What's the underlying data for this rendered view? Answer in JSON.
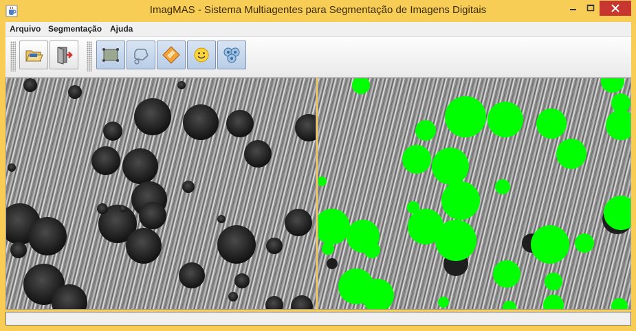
{
  "window": {
    "title": "ImagMAS - Sistema Multiagentes para Segmentação de Imagens Digitais",
    "icon": "java-cup-icon",
    "controls": [
      "minimize",
      "maximize",
      "close"
    ]
  },
  "menu": {
    "items": [
      {
        "label": "Arquivo"
      },
      {
        "label": "Segmentação"
      },
      {
        "label": "Ajuda"
      }
    ]
  },
  "toolbar": {
    "file_group": [
      {
        "icon": "open-folder-icon",
        "active": false
      },
      {
        "icon": "exit-door-icon",
        "active": false
      }
    ],
    "tools_group": [
      {
        "icon": "image-frame-icon",
        "active": true
      },
      {
        "icon": "lasso-blobs-icon",
        "active": true
      },
      {
        "icon": "diamond-warning-icon",
        "active": true
      },
      {
        "icon": "smiley-agent-icon",
        "active": true
      },
      {
        "icon": "multi-agent-icon",
        "active": true
      }
    ]
  },
  "images": {
    "original": {
      "content": "grayscale microscopy image of dark circular particles on scratched metal surface"
    },
    "segmented": {
      "content": "same image with detected particles highlighted",
      "highlight_color": "#00ff00"
    }
  },
  "status": {
    "text": ""
  },
  "colors": {
    "titlebar": "#f8cd55",
    "close_button": "#c7372f",
    "highlight": "#00ff00",
    "toolbar_active": "#b8cde6"
  }
}
